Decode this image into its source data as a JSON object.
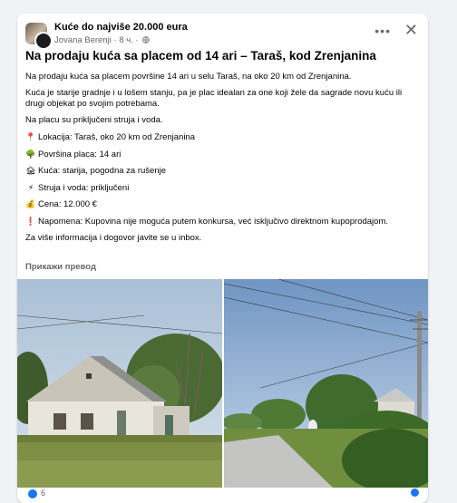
{
  "post": {
    "group_name": "Kuće do najviše 20.000 eura",
    "author": "Jovana Berenji",
    "time": "8 ч.",
    "separator": "·",
    "more_label": "•••",
    "close_label": "✕",
    "title": "Na prodaju kuća sa placem od 14 ari – Taraš, kod Zrenjanina",
    "paragraphs": [
      "Na prodaju kuća sa placem površine 14 ari u selu Taraš, na oko 20 km od Zrenjanina.",
      "Kuća je starije gradnje i u lošem stanju, pa je plac idealan za one koji žele da sagrade novu kuću ili drugi objekat po svojim potrebama.",
      "Na placu su priključeni struja i voda."
    ],
    "details": [
      {
        "icon": "📍",
        "icon_name": "pin-icon",
        "text": "Lokacija: Taraš, oko 20 km od Zrenjanina"
      },
      {
        "icon": "🌳",
        "icon_name": "tree-icon",
        "text": "Površina placa: 14 ari"
      },
      {
        "icon": "🏚",
        "icon_name": "house-icon",
        "text": "Kuća: starija, pogodna za rušenje"
      },
      {
        "icon": "⚡",
        "icon_name": "lightning-icon",
        "text": "Struja i voda: priključeni"
      },
      {
        "icon": "💰",
        "icon_name": "money-icon",
        "text": "Cena: 12.000 €"
      },
      {
        "icon": "❗",
        "icon_name": "exclamation-icon",
        "text": "Napomena: Kupovina nije moguća putem konkursa, već isključivo direktnom kupoprodajom."
      }
    ],
    "closing": "Za više informacija i dogovor javite se u inbox.",
    "translate_label": "Прикажи превод",
    "reactions_count": "6"
  },
  "colors": {
    "background": "#f0f2f5",
    "card": "#ffffff",
    "text_primary": "#050505",
    "text_secondary": "#65676b",
    "accent": "#1877f2"
  }
}
